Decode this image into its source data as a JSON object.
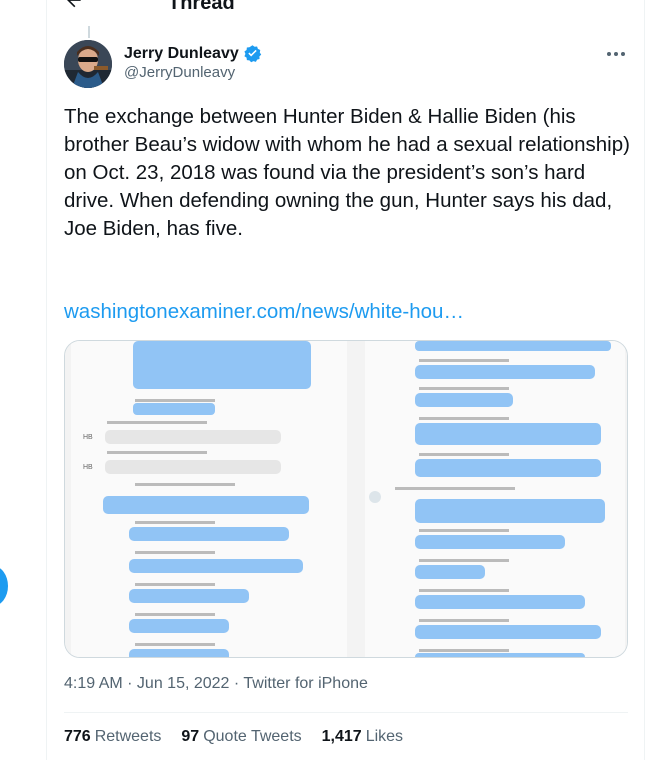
{
  "header": {
    "title": "Thread"
  },
  "author": {
    "display_name": "Jerry Dunleavy",
    "handle": "@JerryDunleavy"
  },
  "tweet": {
    "text": "The exchange between Hunter Biden & Hallie Biden (his brother Beau’s widow with whom he had a sexual relationship) on Oct. 23, 2018 was found via the president’s son’s hard drive. When defending owning the gun, Hunter says his dad, Joe Biden, has five.",
    "link": "washingtonexaminer.com/news/white-hou…"
  },
  "meta": {
    "time": "4:19 AM",
    "separator": " · ",
    "date": "Jun 15, 2022",
    "client": "Twitter for iPhone"
  },
  "stats": {
    "retweets_count": "776",
    "retweets_label": "Retweets",
    "quotes_count": "97",
    "quotes_label": "Quote Tweets",
    "likes_count": "1,417",
    "likes_label": "Likes"
  },
  "colors": {
    "accent": "#1d9bf0",
    "secondary_text": "#536471",
    "bubble_blue": "#91c4f5",
    "bubble_gray": "#e6e6e6"
  }
}
